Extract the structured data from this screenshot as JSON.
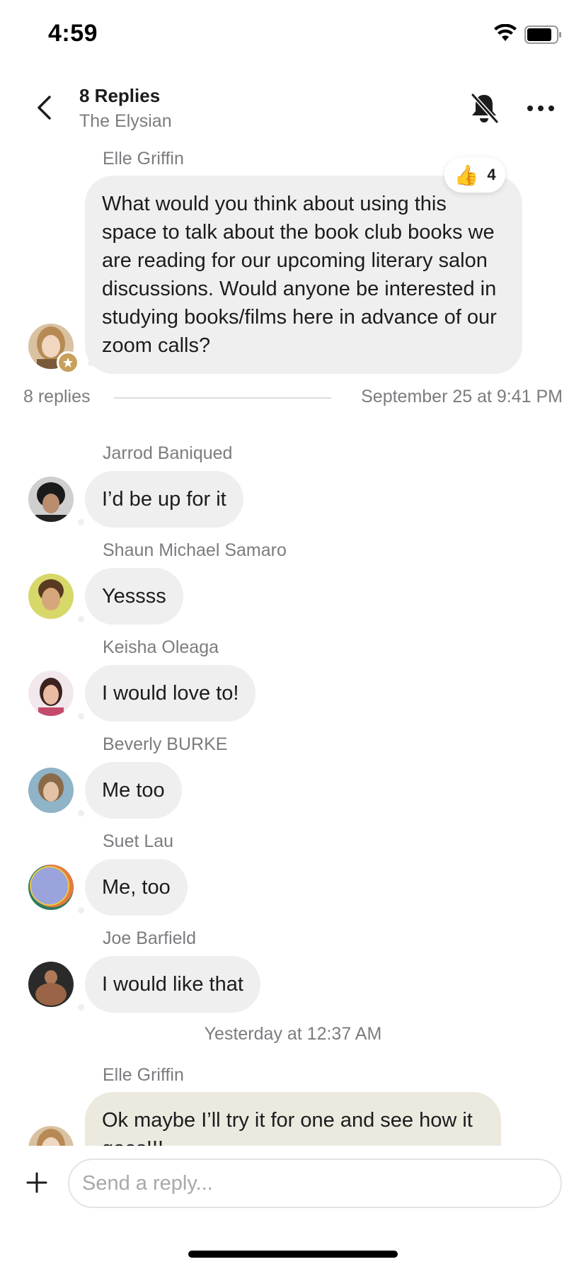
{
  "status_bar": {
    "time": "4:59"
  },
  "header": {
    "title": "8 Replies",
    "subtitle": "The Elysian"
  },
  "parent_message": {
    "sender": "Elle Griffin",
    "text": "What would you think about using this space to talk about the book club books we are reading for our upcoming literary salon discussions. Would anyone be interested in studying books/films here in advance of our zoom calls?",
    "reaction": {
      "emoji": "👍",
      "count": "4"
    }
  },
  "replies_meta": {
    "count_label": "8 replies",
    "date": "September 25 at 9:41 PM"
  },
  "replies": [
    {
      "sender": "Jarrod Baniqued",
      "text": "I’d be up for it"
    },
    {
      "sender": "Shaun Michael Samaro",
      "text": "Yessss"
    },
    {
      "sender": "Keisha Oleaga",
      "text": "I would love to!"
    },
    {
      "sender": "Beverly BURKE",
      "text": "Me too"
    },
    {
      "sender": "Suet Lau",
      "text": "Me, too"
    },
    {
      "sender": "Joe Barfield",
      "text": "I would like that"
    }
  ],
  "day_separator": "Yesterday at 12:37 AM",
  "last_message": {
    "sender": "Elle Griffin",
    "text": "Ok maybe I’ll try it for one and see how it goes!!!"
  },
  "composer": {
    "placeholder": "Send a reply..."
  },
  "colors": {
    "bubble": "#efefef",
    "bubble_highlight": "#ece9df",
    "muted_text": "#7c7c80"
  }
}
